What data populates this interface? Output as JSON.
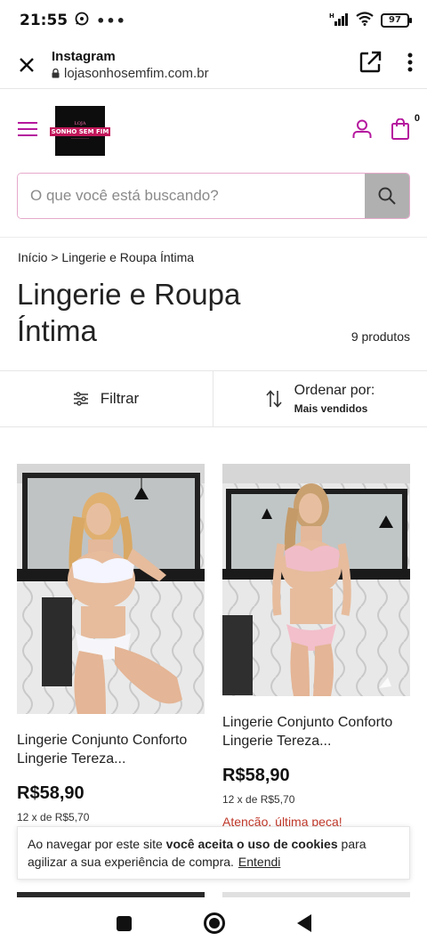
{
  "status_bar": {
    "time": "21:55",
    "battery": "97"
  },
  "browser": {
    "app_name": "Instagram",
    "url": "lojasonhosemfim.com.br"
  },
  "site": {
    "logo_top": "LOJA",
    "logo_main": "SONHO SEM FIM",
    "cart_count": "0",
    "accent_color": "#b5179e"
  },
  "search": {
    "placeholder": "O que você está buscando?"
  },
  "breadcrumb": "Início > Lingerie e Roupa Íntima",
  "page": {
    "title": "Lingerie e Roupa Íntima",
    "product_count": "9 produtos"
  },
  "filter": {
    "label": "Filtrar"
  },
  "sort": {
    "label": "Ordenar por:",
    "value": "Mais vendidos"
  },
  "products": [
    {
      "name": "Lingerie Conjunto Conforto Lingerie Tereza...",
      "price": "R$58,90",
      "installments": "12 x de R$5,70",
      "image_desc": "model-white-lingerie"
    },
    {
      "name": "Lingerie Conjunto Conforto Lingerie Tereza...",
      "price": "R$58,90",
      "installments": "12 x de R$5,70",
      "alert": "Atenção, última peça!",
      "image_desc": "model-pink-lingerie"
    }
  ],
  "cookie": {
    "text_before": "Ao navegar por este site ",
    "text_bold": "você aceita o uso de cookies",
    "text_after": " para agilizar a sua experiência de compra.",
    "link": "Entendi"
  }
}
